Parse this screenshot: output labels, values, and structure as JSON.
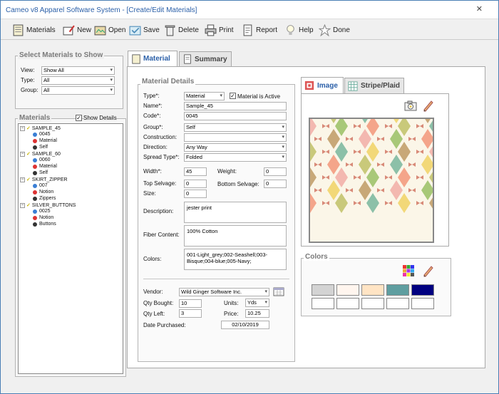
{
  "window": {
    "title": "Cameo v8 Apparel Software System - [Create/Edit Materials]",
    "close": "✕"
  },
  "toolbar": {
    "materials": "Materials",
    "new": "New",
    "open": "Open",
    "save": "Save",
    "delete": "Delete",
    "print": "Print",
    "report": "Report",
    "help": "Help",
    "done": "Done"
  },
  "filter": {
    "title": "Select Materials to Show",
    "view_label": "View:",
    "view_value": "Show All",
    "type_label": "Type:",
    "type_value": "All",
    "group_label": "Group:",
    "group_value": "All"
  },
  "materials_panel": {
    "title": "Materials",
    "show_details_label": "Show Details",
    "show_details_checked": true,
    "tree": [
      {
        "name": "SAMPLE_45",
        "children": [
          {
            "text": "0045",
            "color": "#3a7fd5"
          },
          {
            "text": "Material",
            "color": "#d33"
          },
          {
            "text": "Self",
            "color": "#333"
          }
        ]
      },
      {
        "name": "SAMPLE_60",
        "children": [
          {
            "text": "0060",
            "color": "#3a7fd5"
          },
          {
            "text": "Material",
            "color": "#d33"
          },
          {
            "text": "Self",
            "color": "#333"
          }
        ]
      },
      {
        "name": "SKIRT_ZIPPER",
        "children": [
          {
            "text": "007",
            "color": "#3a7fd5"
          },
          {
            "text": "Notion",
            "color": "#d33"
          },
          {
            "text": "Zippers",
            "color": "#333"
          }
        ]
      },
      {
        "name": "SILVER_BUTTONS",
        "children": [
          {
            "text": "0025",
            "color": "#3a7fd5"
          },
          {
            "text": "Notion",
            "color": "#d33"
          },
          {
            "text": "Buttons",
            "color": "#333"
          }
        ]
      }
    ]
  },
  "tabs": {
    "material": "Material",
    "summary": "Summary"
  },
  "details": {
    "title": "Material Details",
    "type_label": "Type*:",
    "type_value": "Material",
    "active_label": "Material is Active",
    "active_checked": true,
    "name_label": "Name*:",
    "name_value": "Sample_45",
    "code_label": "Code*:",
    "code_value": "0045",
    "group_label": "Group*:",
    "group_value": "Self",
    "construction_label": "Construction:",
    "construction_value": "",
    "direction_label": "Direction:",
    "direction_value": "Any Way",
    "spread_label": "Spread Type*:",
    "spread_value": "Folded",
    "width_label": "Width*:",
    "width_value": "45",
    "weight_label": "Weight:",
    "weight_value": "0",
    "top_selvage_label": "Top Selvage:",
    "top_selvage_value": "0",
    "bottom_selvage_label": "Bottom Selvage:",
    "bottom_selvage_value": "0",
    "size_label": "Size:",
    "size_value": "0",
    "description_label": "Description:",
    "description_value": "jester print",
    "fiber_label": "Fiber Content:",
    "fiber_value": "100% Cotton",
    "colors_label": "Colors:",
    "colors_value": "001-Light_grey;002-Seashell;003-Bisque;004-blue;005-Navy;",
    "vendor_label": "Vendor:",
    "vendor_value": "Wild Ginger Software Inc.",
    "qty_bought_label": "Qty Bought:",
    "qty_bought_value": "10",
    "units_label": "Units:",
    "units_value": "Yds",
    "qty_left_label": "Qty Left:",
    "qty_left_value": "3",
    "price_label": "Price:",
    "price_value": "10.25",
    "date_label": "Date Purchased:",
    "date_value": "02/10/2019"
  },
  "image_tabs": {
    "image": "Image",
    "stripe": "Stripe/Plaid"
  },
  "colors_panel": {
    "title": "Colors",
    "swatches": [
      "#d3d3d3",
      "#fff5ee",
      "#ffe4c4",
      "#5f9ea0",
      "#000080"
    ]
  }
}
